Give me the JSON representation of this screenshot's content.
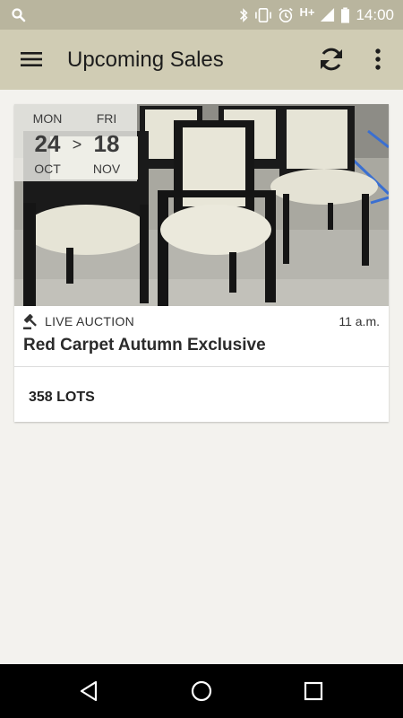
{
  "status_bar": {
    "time": "14:00",
    "network": "H+",
    "icons": [
      "search-icon",
      "bluetooth-icon",
      "vibrate-icon",
      "alarm-icon",
      "signal-icon",
      "battery-icon"
    ]
  },
  "app_bar": {
    "title": "Upcoming Sales",
    "icons": [
      "menu-icon",
      "refresh-icon",
      "more-vert-icon"
    ],
    "background": "#d0ccb4"
  },
  "sale": {
    "start": {
      "dow": "MON",
      "day": "24",
      "month": "OCT"
    },
    "end": {
      "dow": "FRI",
      "day": "18",
      "month": "NOV"
    },
    "separator": ">",
    "type": "LIVE AUCTION",
    "time": "11 a.m.",
    "title": "Red Carpet Autumn Exclusive",
    "lots": "358 LOTS",
    "type_icon": "gavel-icon"
  },
  "nav_bar": {
    "icons": [
      "back-icon",
      "home-icon",
      "recents-icon"
    ]
  }
}
